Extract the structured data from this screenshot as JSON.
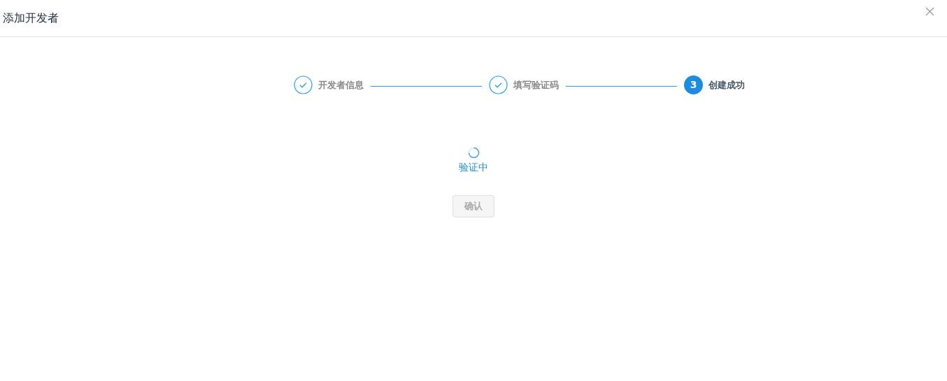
{
  "dialog": {
    "title": "添加开发者"
  },
  "steps": [
    {
      "label": "开发者信息",
      "done": true
    },
    {
      "label": "填写验证码",
      "done": true
    },
    {
      "label": "创建成功",
      "done": false,
      "number": "3"
    }
  ],
  "progress": {
    "text": "验证中"
  },
  "confirm_button": {
    "label": "确认",
    "disabled": true
  }
}
